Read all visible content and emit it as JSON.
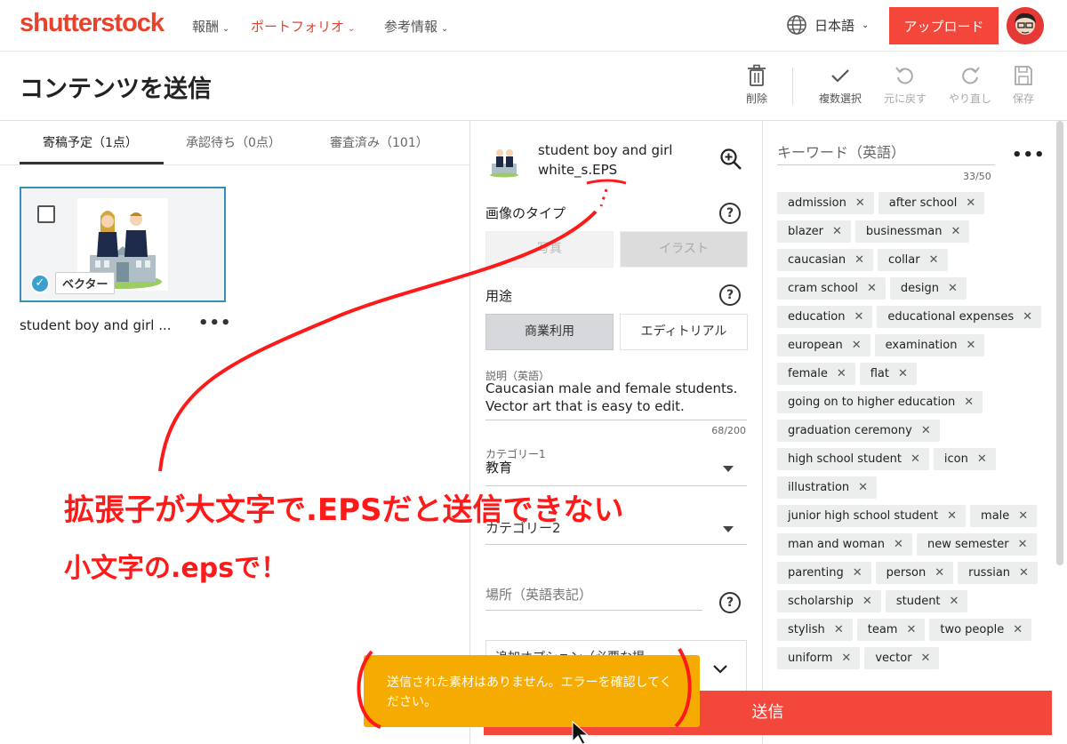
{
  "nav": {
    "logo": "shutterstock",
    "items": [
      {
        "label": "報酬"
      },
      {
        "label": "ポートフォリオ"
      },
      {
        "label": "参考情報"
      }
    ],
    "language": "日本語",
    "upload": "アップロード"
  },
  "page": {
    "title": "コンテンツを送信",
    "tools": {
      "delete": "削除",
      "multi_select": "複数選択",
      "undo": "元に戻す",
      "redo": "やり直し",
      "save": "保存"
    }
  },
  "tabs": [
    {
      "label": "寄稿予定（1点）"
    },
    {
      "label": "承認待ち（0点）"
    },
    {
      "label": "審査済み（101）"
    }
  ],
  "card": {
    "badge": "ベクター",
    "name": "student boy and girl ...",
    "more": "•••"
  },
  "details": {
    "file_name": "student boy and girl white_s.EPS",
    "image_type": {
      "label": "画像のタイプ",
      "options": [
        "写真",
        "イラスト"
      ],
      "selected": "イラスト"
    },
    "usage": {
      "label": "用途",
      "options": [
        "商業利用",
        "エディトリアル"
      ],
      "selected": "商業利用"
    },
    "description": {
      "label": "説明（英語）",
      "value": "Caucasian male and female students. Vector art that is easy to edit.",
      "counter": "68/200"
    },
    "category1": {
      "label": "カテゴリー1",
      "value": "教育"
    },
    "category2": {
      "placeholder": "カテゴリー2"
    },
    "location": {
      "placeholder": "場所（英語表記）"
    },
    "options_text": "追加オプション（必要な場",
    "submit": "送信"
  },
  "toast": "送信された素材はありません。エラーを確認してください。",
  "keywords": {
    "title": "キーワード（英語）",
    "count": "33/50",
    "more": "•••",
    "items": [
      "admission",
      "after school",
      "blazer",
      "businessman",
      "caucasian",
      "collar",
      "cram school",
      "design",
      "education",
      "educational expenses",
      "european",
      "examination",
      "female",
      "flat",
      "going on to higher education",
      "graduation ceremony",
      "high school student",
      "icon",
      "illustration",
      "junior high school student",
      "male",
      "man and woman",
      "new semester",
      "parenting",
      "person",
      "russian",
      "scholarship",
      "student",
      "stylish",
      "team",
      "two people",
      "uniform",
      "vector"
    ]
  },
  "annotation": {
    "line1": "拡張子が大文字で.EPSだと送信できない",
    "line2": "小文字の.epsで！"
  },
  "colors": {
    "brand": "#e8412c",
    "accent": "#f2473a",
    "toast": "#f5ab00",
    "selection": "#3a8fb7",
    "annotation": "#ff1a1a"
  }
}
